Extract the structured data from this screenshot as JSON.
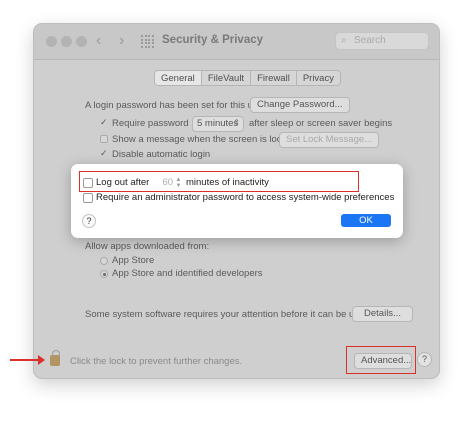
{
  "window": {
    "title": "Security & Privacy",
    "search_placeholder": "Search",
    "nav_back": "‹",
    "nav_forward": "›"
  },
  "tabs": [
    {
      "label": "General",
      "active": true
    },
    {
      "label": "FileVault",
      "active": false
    },
    {
      "label": "Firewall",
      "active": false
    },
    {
      "label": "Privacy",
      "active": false
    }
  ],
  "general": {
    "login_password_text": "A login password has been set for this user",
    "change_password_label": "Change Password...",
    "require_password_label": "Require password",
    "require_password_checked": true,
    "require_password_value": "5 minutes",
    "require_password_suffix": "after sleep or screen saver begins",
    "show_message_label": "Show a message when the screen is locked",
    "show_message_checked": false,
    "set_lock_message_label": "Set Lock Message...",
    "disable_auto_login_label": "Disable automatic login",
    "disable_auto_login_checked": true,
    "allow_apps_label": "Allow apps downloaded from:",
    "app_store_option": "App Store",
    "app_store_identified_option": "App Store and identified developers",
    "selected_option": "App Store and identified developers",
    "system_software_text": "Some system software requires your attention before it can be used.",
    "details_label": "Details..."
  },
  "footer": {
    "lock_text": "Click the lock to prevent further changes.",
    "advanced_label": "Advanced...",
    "help_label": "?"
  },
  "dialog": {
    "logout_label": "Log out after",
    "logout_checked": false,
    "logout_minutes": "60",
    "logout_suffix": "minutes of inactivity",
    "require_admin_label": "Require an administrator password to access system-wide preferences",
    "require_admin_checked": false,
    "ok_label": "OK",
    "help_label": "?"
  },
  "colors": {
    "annotation_red": "#d9302b",
    "ok_blue": "#1a76f2"
  }
}
